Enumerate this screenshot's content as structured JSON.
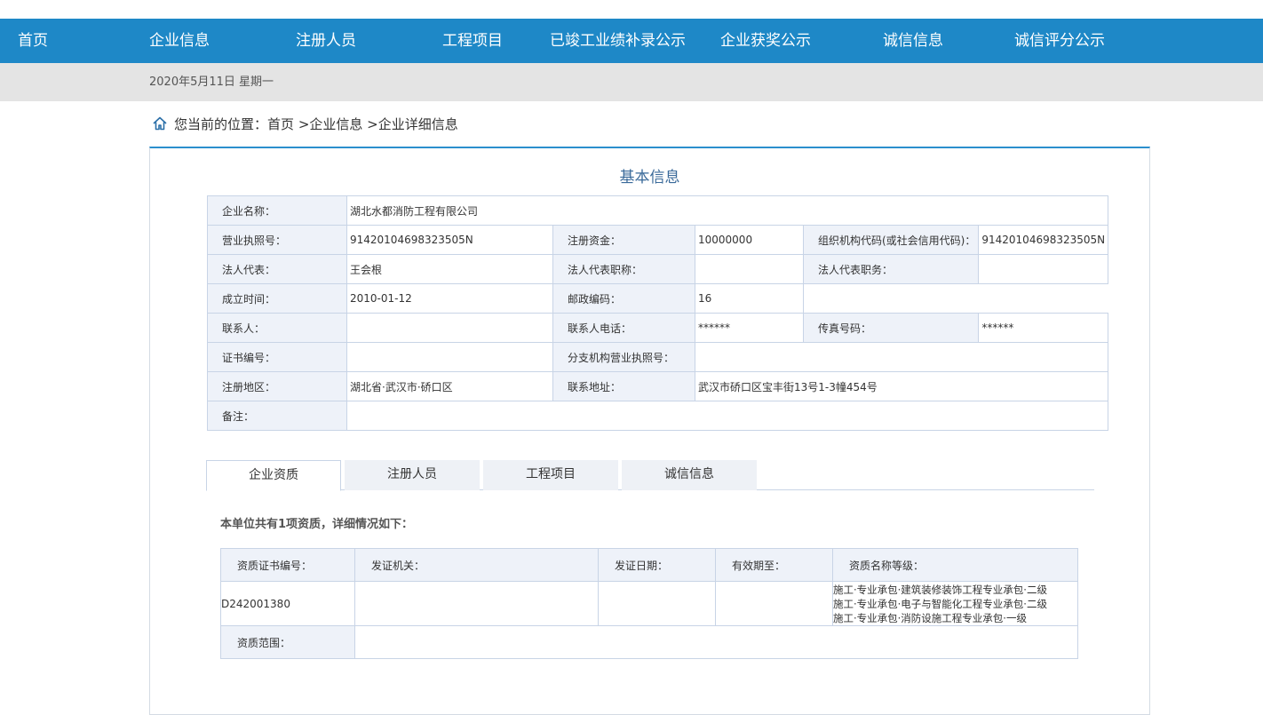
{
  "nav": {
    "items": [
      "首页",
      "企业信息",
      "注册人员",
      "工程项目",
      "已竣工业绩补录公示",
      "企业获奖公示",
      "诚信信息",
      "诚信评分公示"
    ]
  },
  "date": "2020年5月11日 星期一",
  "breadcrumb": {
    "prefix": "您当前的位置：",
    "items": [
      "首页",
      ">企业信息",
      ">企业详细信息"
    ]
  },
  "section_title": "基本信息",
  "info": {
    "company_name_label": "企业名称：",
    "company_name": "湖北水都消防工程有限公司",
    "license_label": "营业执照号：",
    "license": "91420104698323505N",
    "capital_label": "注册资金：",
    "capital": "10000000",
    "org_code_label": "组织机构代码(或社会信用代码)：",
    "org_code": "91420104698323505N",
    "legal_rep_label": "法人代表：",
    "legal_rep": "王会根",
    "legal_title_label": "法人代表职称：",
    "legal_title": "",
    "legal_position_label": "法人代表职务：",
    "legal_position": "",
    "founded_label": "成立时间：",
    "founded": "2010-01-12",
    "postcode_label": "邮政编码：",
    "postcode": "16",
    "contact_label": "联系人：",
    "contact": "",
    "contact_phone_label": "联系人电话：",
    "contact_phone": "******",
    "fax_label": "传真号码：",
    "fax": "******",
    "cert_no_label": "证书编号：",
    "cert_no": "",
    "branch_license_label": "分支机构营业执照号：",
    "branch_license": "",
    "region_label": "注册地区：",
    "region": "湖北省·武汉市·硚口区",
    "address_label": "联系地址：",
    "address": "武汉市硚口区宝丰街13号1-3幢454号",
    "remark_label": "备注：",
    "remark": ""
  },
  "tabs": [
    "企业资质",
    "注册人员",
    "工程项目",
    "诚信信息"
  ],
  "summary": "本单位共有1项资质，详细情况如下：",
  "qualification": {
    "headers": [
      "资质证书编号：",
      "发证机关：",
      "发证日期：",
      "有效期至：",
      "资质名称等级："
    ],
    "cert_no": "D242001380",
    "issuer": "",
    "issue_date": "",
    "valid_until": "",
    "grades": [
      "施工·专业承包·建筑装修装饰工程专业承包·二级",
      "施工·专业承包·电子与智能化工程专业承包·二级",
      "施工·专业承包·消防设施工程专业承包·一级"
    ],
    "scope_label": "资质范围：",
    "scope": ""
  },
  "colors": {
    "nav_bg": "#1e88c7",
    "date_bar_bg": "#e4e4e4",
    "label_bg": "#eef2f9",
    "border": "#c8d4e6",
    "title_text": "#3a6a9a"
  }
}
